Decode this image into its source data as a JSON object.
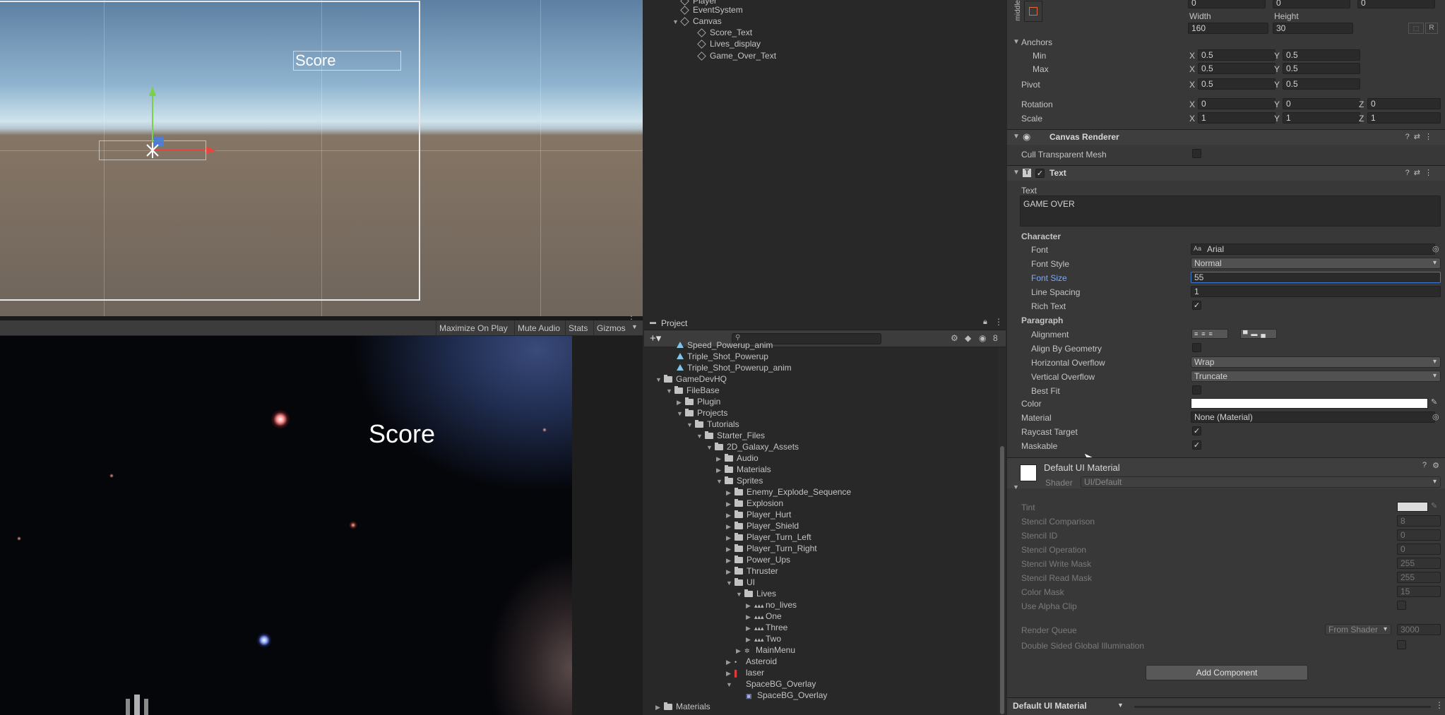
{
  "scene": {
    "score_label": "Score"
  },
  "game": {
    "toolbar": {
      "maximize": "Maximize On Play",
      "mute": "Mute Audio",
      "stats": "Stats",
      "gizmos": "Gizmos"
    },
    "score_text": "Score"
  },
  "hierarchy": {
    "items": [
      {
        "label": "Player"
      },
      {
        "label": "EventSystem"
      },
      {
        "label": "Canvas"
      },
      {
        "label": "Score_Text"
      },
      {
        "label": "Lives_display"
      },
      {
        "label": "Game_Over_Text"
      }
    ]
  },
  "project": {
    "tab": "Project",
    "hidden_count": "8",
    "items": [
      {
        "label": "Speed_Powerup_anim"
      },
      {
        "label": "Triple_Shot_Powerup"
      },
      {
        "label": "Triple_Shot_Powerup_anim"
      },
      {
        "label": "GameDevHQ"
      },
      {
        "label": "FileBase"
      },
      {
        "label": "Plugin"
      },
      {
        "label": "Projects"
      },
      {
        "label": "Tutorials"
      },
      {
        "label": "Starter_Files"
      },
      {
        "label": "2D_Galaxy_Assets"
      },
      {
        "label": "Audio"
      },
      {
        "label": "Materials"
      },
      {
        "label": "Sprites"
      },
      {
        "label": "Enemy_Explode_Sequence"
      },
      {
        "label": "Explosion"
      },
      {
        "label": "Player_Hurt"
      },
      {
        "label": "Player_Shield"
      },
      {
        "label": "Player_Turn_Left"
      },
      {
        "label": "Player_Turn_Right"
      },
      {
        "label": "Power_Ups"
      },
      {
        "label": "Thruster"
      },
      {
        "label": "UI"
      },
      {
        "label": "Lives"
      },
      {
        "label": "no_lives"
      },
      {
        "label": "One"
      },
      {
        "label": "Three"
      },
      {
        "label": "Two"
      },
      {
        "label": "MainMenu"
      },
      {
        "label": "Asteroid"
      },
      {
        "label": "laser"
      },
      {
        "label": "SpaceBG_Overlay"
      },
      {
        "label": "SpaceBG_Overlay"
      },
      {
        "label": "Materials"
      }
    ]
  },
  "inspector": {
    "rect": {
      "anchor_preset": "middle",
      "pos_values": [
        "0",
        "0",
        "0"
      ],
      "width_label": "Width",
      "height_label": "Height",
      "width": "160",
      "height": "30",
      "r_button": "R",
      "anchors_label": "Anchors",
      "min_label": "Min",
      "min_x": "0.5",
      "min_y": "0.5",
      "max_label": "Max",
      "max_x": "0.5",
      "max_y": "0.5",
      "pivot_label": "Pivot",
      "pivot_x": "0.5",
      "pivot_y": "0.5",
      "rotation_label": "Rotation",
      "rot_x": "0",
      "rot_y": "0",
      "rot_z": "0",
      "scale_label": "Scale",
      "scale_x": "1",
      "scale_y": "1",
      "scale_z": "1",
      "axis_x": "X",
      "axis_y": "Y",
      "axis_z": "Z"
    },
    "canvas_renderer": {
      "title": "Canvas Renderer",
      "cull_label": "Cull Transparent Mesh"
    },
    "text": {
      "title": "Text",
      "text_label": "Text",
      "text_value": "GAME OVER",
      "character_label": "Character",
      "font_label": "Font",
      "font_value": "Arial",
      "font_style_label": "Font Style",
      "font_style_value": "Normal",
      "font_size_label": "Font Size",
      "font_size_value": "55",
      "line_spacing_label": "Line Spacing",
      "line_spacing_value": "1",
      "rich_text_label": "Rich Text",
      "paragraph_label": "Paragraph",
      "alignment_label": "Alignment",
      "align_geometry_label": "Align By Geometry",
      "h_overflow_label": "Horizontal Overflow",
      "h_overflow_value": "Wrap",
      "v_overflow_label": "Vertical Overflow",
      "v_overflow_value": "Truncate",
      "best_fit_label": "Best Fit",
      "color_label": "Color",
      "material_label": "Material",
      "material_value": "None (Material)",
      "raycast_label": "Raycast Target",
      "maskable_label": "Maskable"
    },
    "material": {
      "title": "Default UI Material",
      "shader_label": "Shader",
      "shader_value": "UI/Default",
      "tint_label": "Tint",
      "stencil_comparison_label": "Stencil Comparison",
      "stencil_comparison_value": "8",
      "stencil_id_label": "Stencil ID",
      "stencil_id_value": "0",
      "stencil_operation_label": "Stencil Operation",
      "stencil_operation_value": "0",
      "stencil_write_label": "Stencil Write Mask",
      "stencil_write_value": "255",
      "stencil_read_label": "Stencil Read Mask",
      "stencil_read_value": "255",
      "color_mask_label": "Color Mask",
      "color_mask_value": "15",
      "alpha_clip_label": "Use Alpha Clip",
      "render_queue_label": "Render Queue",
      "render_queue_mode": "From Shader",
      "render_queue_value": "3000",
      "double_sided_label": "Double Sided Global Illumination"
    },
    "add_component": "Add Component",
    "bottom_label": "Default UI Material"
  }
}
